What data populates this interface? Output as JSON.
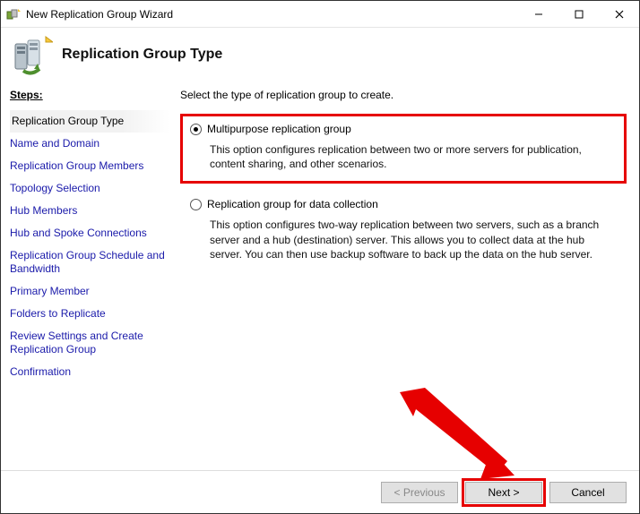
{
  "window": {
    "title": "New Replication Group Wizard"
  },
  "header": {
    "page_title": "Replication Group Type"
  },
  "steps": {
    "label": "Steps:",
    "items": [
      "Replication Group Type",
      "Name and Domain",
      "Replication Group Members",
      "Topology Selection",
      "Hub Members",
      "Hub and Spoke Connections",
      "Replication Group Schedule and Bandwidth",
      "Primary Member",
      "Folders to Replicate",
      "Review Settings and Create Replication Group",
      "Confirmation"
    ],
    "active_index": 0
  },
  "main": {
    "instruction": "Select the type of replication group to create.",
    "options": [
      {
        "title": "Multipurpose replication group",
        "desc": "This option configures replication between two or more servers for publication, content sharing, and other scenarios.",
        "selected": true,
        "highlight": true
      },
      {
        "title": "Replication group for data collection",
        "desc": "This option configures two-way replication between two servers, such as a branch server and a hub (destination) server. This allows you to collect data at the hub server. You can then use backup software to back up the data on the hub server.",
        "selected": false,
        "highlight": false
      }
    ]
  },
  "footer": {
    "previous": "< Previous",
    "next": "Next >",
    "cancel": "Cancel"
  }
}
